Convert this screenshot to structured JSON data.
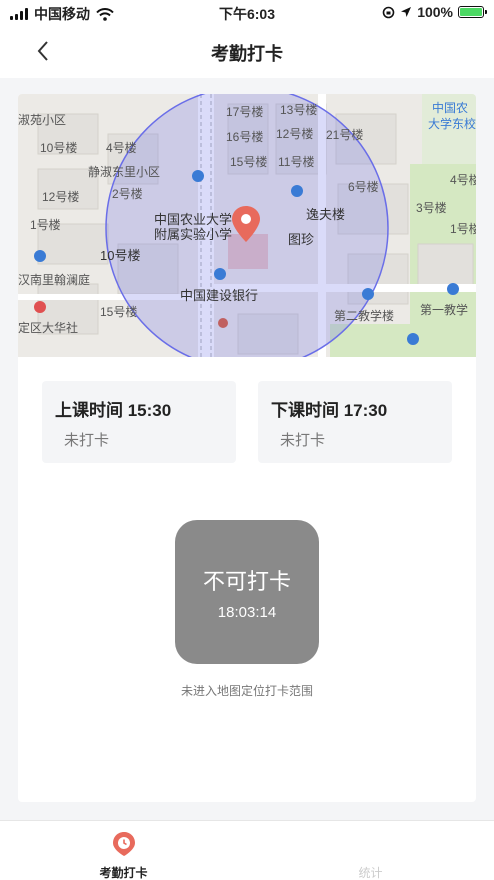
{
  "status_bar": {
    "carrier": "中国移动",
    "time": "下午6:03",
    "battery_percent": "100%",
    "battery_level": 1.0
  },
  "nav": {
    "title": "考勤打卡",
    "back_icon": "chevron-left-icon"
  },
  "map": {
    "labels": [
      "淑苑小区",
      "10号楼",
      "4号楼",
      "静淑东里小区",
      "12号楼",
      "2号楼",
      "1号楼",
      "17号楼",
      "13号楼",
      "16号楼",
      "12号楼",
      "21号楼",
      "15号楼",
      "11号楼",
      "6号楼",
      "中国农业大学",
      "附属实验小学",
      "逸夫楼",
      "图珍",
      "中国建设银行",
      "10号楼",
      "汉南里翰澜庭",
      "15号楼",
      "第二教学楼",
      "第一教学",
      "定区大华社",
      "中国农",
      "大学东校",
      "4号楼",
      "3号楼",
      "1号楼"
    ],
    "accent_color": "#e86a5c",
    "range_color": "#6a6ee8"
  },
  "class_start": {
    "title": "上课时间 15:30",
    "status": "未打卡"
  },
  "class_end": {
    "title": "下课时间 17:30",
    "status": "未打卡"
  },
  "punch": {
    "label": "不可打卡",
    "time": "18:03:14",
    "button_color": "#8a8a8a"
  },
  "hint": "未进入地图定位打卡范围",
  "tabs": [
    {
      "label": "考勤打卡",
      "icon": "clock-pin-icon"
    },
    {
      "label": "统计",
      "icon": ""
    }
  ]
}
